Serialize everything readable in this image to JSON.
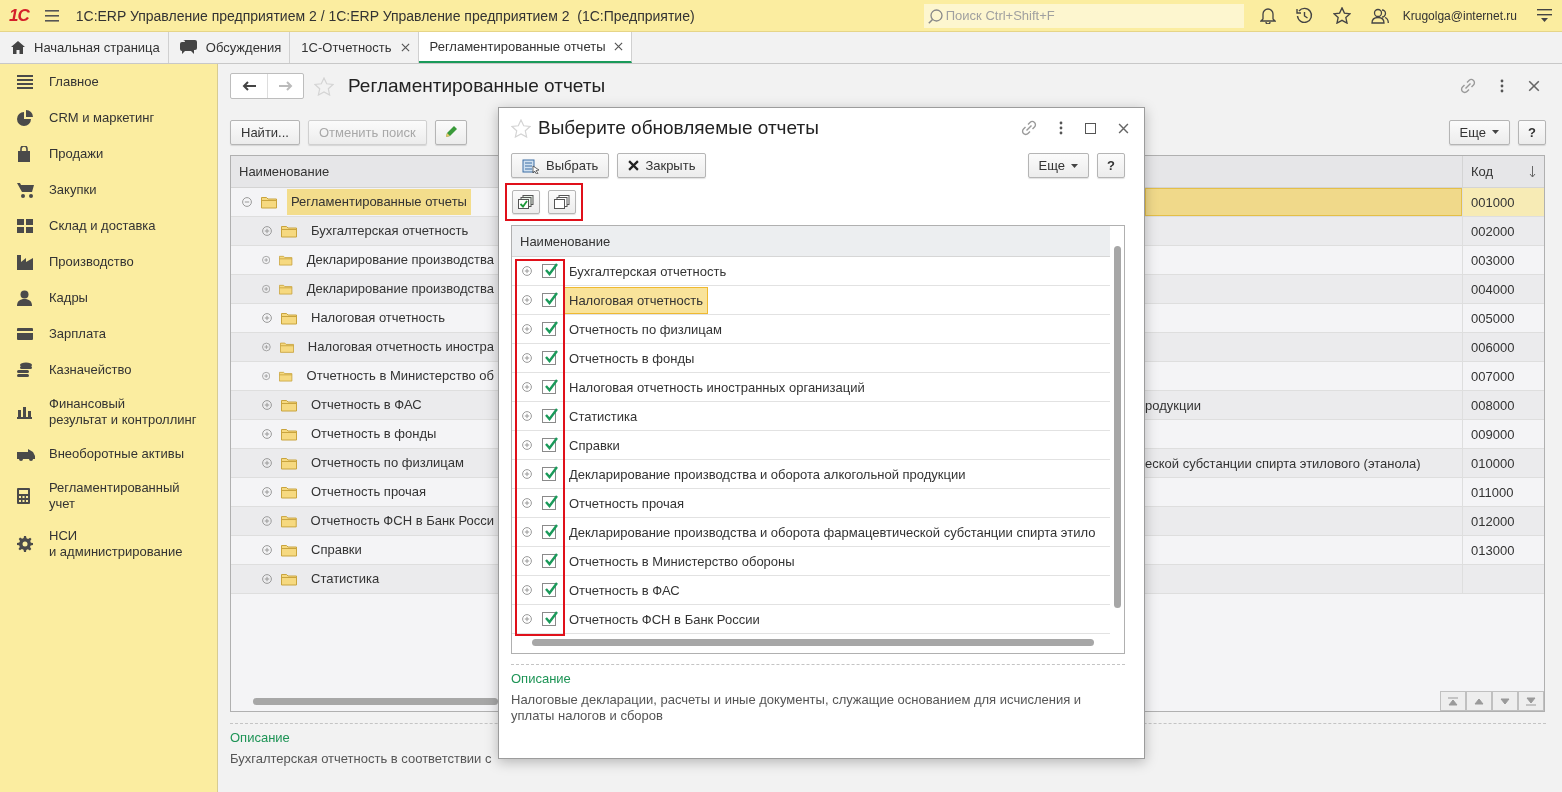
{
  "app_bar": {
    "logo": "1С",
    "title": "1С:ERP Управление предприятием 2 / 1С:ERP Управление предприятием 2  (1С:Предприятие)",
    "search": {
      "placeholder": "Поиск Ctrl+Shift+F"
    },
    "user": "Krugolga@internet.ru"
  },
  "tabs": [
    {
      "label": "Начальная страница",
      "closable": false,
      "selected": false
    },
    {
      "label": "Обсуждения",
      "closable": false,
      "selected": false
    },
    {
      "label": "1С-Отчетность",
      "closable": true,
      "selected": false
    },
    {
      "label": "Регламентированные отчеты",
      "closable": true,
      "selected": true
    }
  ],
  "sidebar": {
    "items": [
      {
        "label": "Главное"
      },
      {
        "label": "CRM и маркетинг"
      },
      {
        "label": "Продажи"
      },
      {
        "label": "Закупки"
      },
      {
        "label": "Склад и доставка"
      },
      {
        "label": "Производство"
      },
      {
        "label": "Кадры"
      },
      {
        "label": "Зарплата"
      },
      {
        "label": "Казначейство"
      },
      {
        "label": "Финансовый\nрезультат и контроллинг"
      },
      {
        "label": "Внеоборотные активы"
      },
      {
        "label": "Регламентированный\nучет"
      },
      {
        "label": "НСИ\nи администрирование"
      }
    ]
  },
  "form": {
    "title": "Регламентированные отчеты",
    "toolbar": {
      "find": "Найти...",
      "cancel_search": {
        "label": "Отменить поиск",
        "disabled": true
      },
      "more": "Еще",
      "help": "?"
    },
    "table": {
      "columns": [
        "Наименование",
        "Код"
      ],
      "rows": [
        {
          "name": "Регламентированные отчеты",
          "code": "001000",
          "selected": true,
          "expanded": true,
          "children": [
            {
              "name": "Бухгалтерская отчетность",
              "code": "002000",
              "expanded": false,
              "selected": false
            },
            {
              "name": "Декларирование производства",
              "code": "003000",
              "expanded": false,
              "selected": false
            },
            {
              "name": "Декларирование производства",
              "code": "004000",
              "expanded": false,
              "selected": false
            },
            {
              "name": "Налоговая отчетность",
              "code": "005000",
              "expanded": false,
              "selected": false
            },
            {
              "name": "Налоговая отчетность иностра",
              "code": "006000",
              "expanded": false,
              "selected": false
            },
            {
              "name": "Отчетность в Министерство об",
              "code": "007000",
              "expanded": false,
              "selected": false
            },
            {
              "name": "Отчетность в ФАС",
              "column_2": "родукции",
              "code": "008000",
              "expanded": false,
              "selected": false
            },
            {
              "name": "Отчетность в фонды",
              "code": "009000",
              "expanded": false,
              "selected": false
            },
            {
              "name": "Отчетность по физлицам",
              "column_2": "еской субстанции спирта этилового (этанола)",
              "code": "010000",
              "expanded": false,
              "selected": false
            },
            {
              "name": "Отчетность прочая",
              "code": "011000",
              "expanded": false,
              "selected": false
            },
            {
              "name": "Отчетность ФСН в Банк Росси",
              "code": "012000",
              "expanded": false,
              "selected": false
            },
            {
              "name": "Справки",
              "code": "013000",
              "expanded": false,
              "selected": false
            },
            {
              "name": "Статистика",
              "expanded": false,
              "selected": false
            }
          ]
        }
      ]
    },
    "description": {
      "label": "Описание",
      "text": "Бухгалтерская отчетность в соответствии с"
    }
  },
  "dialog": {
    "title": "Выберите обновляемые отчеты",
    "toolbar": {
      "select": "Выбрать",
      "close": "Закрыть",
      "more": "Еще",
      "help": "?"
    },
    "list": {
      "column": "Наименование",
      "rows": [
        {
          "name": "Бухгалтерская отчетность",
          "checked": true,
          "selected": false,
          "expanded": false
        },
        {
          "name": "Налоговая отчетность",
          "checked": true,
          "selected": true,
          "expanded": false
        },
        {
          "name": "Отчетность по физлицам",
          "checked": true,
          "selected": false,
          "expanded": false
        },
        {
          "name": "Отчетность в фонды",
          "checked": true,
          "selected": false,
          "expanded": false
        },
        {
          "name": "Налоговая отчетность иностранных организаций",
          "checked": true,
          "selected": false,
          "expanded": false
        },
        {
          "name": "Статистика",
          "checked": true,
          "selected": false,
          "expanded": false
        },
        {
          "name": "Справки",
          "checked": true,
          "selected": false,
          "expanded": false
        },
        {
          "name": "Декларирование производства и оборота алкогольной продукции",
          "checked": true,
          "selected": false,
          "expanded": false
        },
        {
          "name": "Отчетность прочая",
          "checked": true,
          "selected": false,
          "expanded": false
        },
        {
          "name": "Декларирование производства и оборота фармацевтической субстанции спирта этило",
          "checked": true,
          "selected": false,
          "expanded": false
        },
        {
          "name": "Отчетность в Министерство обороны",
          "checked": true,
          "selected": false,
          "expanded": false
        },
        {
          "name": "Отчетность в ФАС",
          "checked": true,
          "selected": false,
          "expanded": false
        },
        {
          "name": "Отчетность ФСН в Банк России",
          "checked": true,
          "selected": false,
          "expanded": false
        }
      ]
    },
    "description": {
      "label": "Описание",
      "text": "Налоговые декларации, расчеты и иные документы, служащие основанием для исчисления и уплаты налогов и сборов"
    }
  }
}
